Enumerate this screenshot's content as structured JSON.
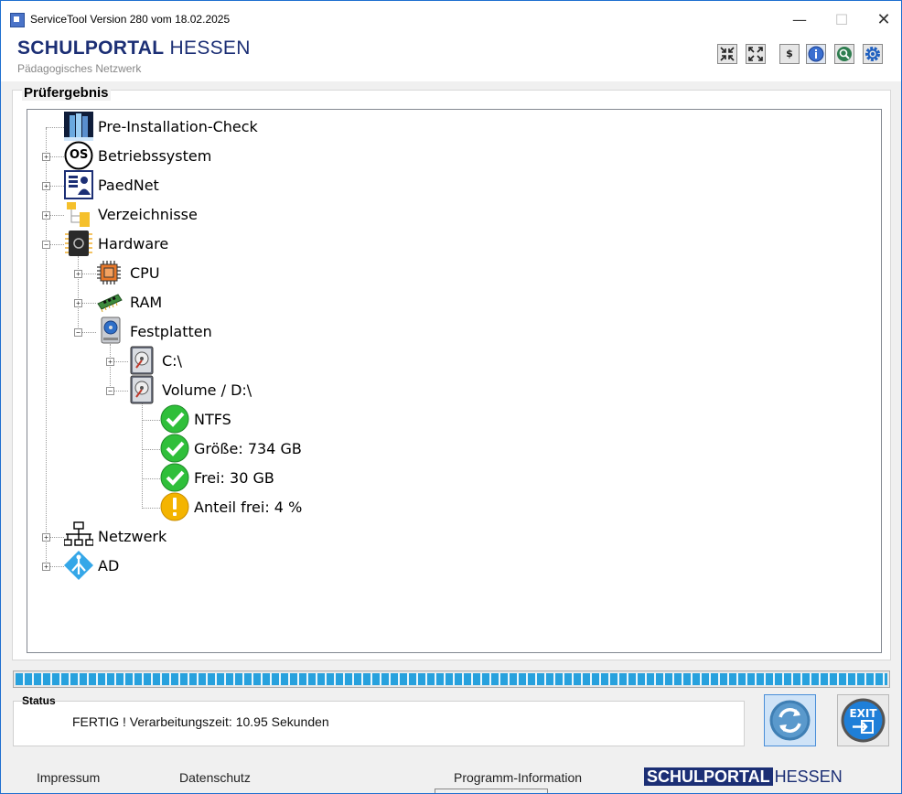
{
  "window": {
    "title": "ServiceTool Version 280 vom 18.02.2025",
    "minimize": "—",
    "maximize": "☐",
    "close": "✕"
  },
  "header": {
    "brand_bold": "SCHULPORTAL",
    "brand_light": "HESSEN",
    "subtitle": "Pädagogisches Netzwerk",
    "tools": [
      {
        "name": "collapse-all",
        "glyph": "✖"
      },
      {
        "name": "expand-all",
        "glyph": "⤢"
      },
      {
        "name": "dollar",
        "glyph": "$"
      },
      {
        "name": "info",
        "glyph": "i"
      },
      {
        "name": "search",
        "glyph": "🔍"
      },
      {
        "name": "settings",
        "glyph": "⚙"
      }
    ]
  },
  "results": {
    "title": "Prüfergebnis",
    "tree": {
      "preinstall": "Pre-Installation-Check",
      "os": "Betriebssystem",
      "os_badge": "OS",
      "paednet": "PaedNet",
      "folders": "Verzeichnisse",
      "hardware": "Hardware",
      "cpu": "CPU",
      "ram": "RAM",
      "disks": "Festplatten",
      "drive_c": "C:\\",
      "drive_d": "Volume / D:\\",
      "d_fs": "NTFS",
      "d_size": "Größe: 734 GB",
      "d_free": "Frei:  30 GB",
      "d_free_pct": "Anteil frei: 4 %",
      "network": "Netzwerk",
      "ad": "AD"
    },
    "expander_plus": "+",
    "expander_minus": "−"
  },
  "progress": {
    "value_percent": 100,
    "color": "#27a1dd"
  },
  "status": {
    "title": "Status",
    "text": "FERTIG !  Verarbeitungszeit: 10.95 Sekunden"
  },
  "footer": {
    "impressum": "Impressum",
    "datenschutz": "Datenschutz",
    "program_info": "Programm-Information",
    "brand_bold": "SCHULPORTAL",
    "brand_light": "HESSEN"
  },
  "colors": {
    "brand": "#1c2f75",
    "ok": "#2fbf3a",
    "warn": "#f4b400"
  }
}
